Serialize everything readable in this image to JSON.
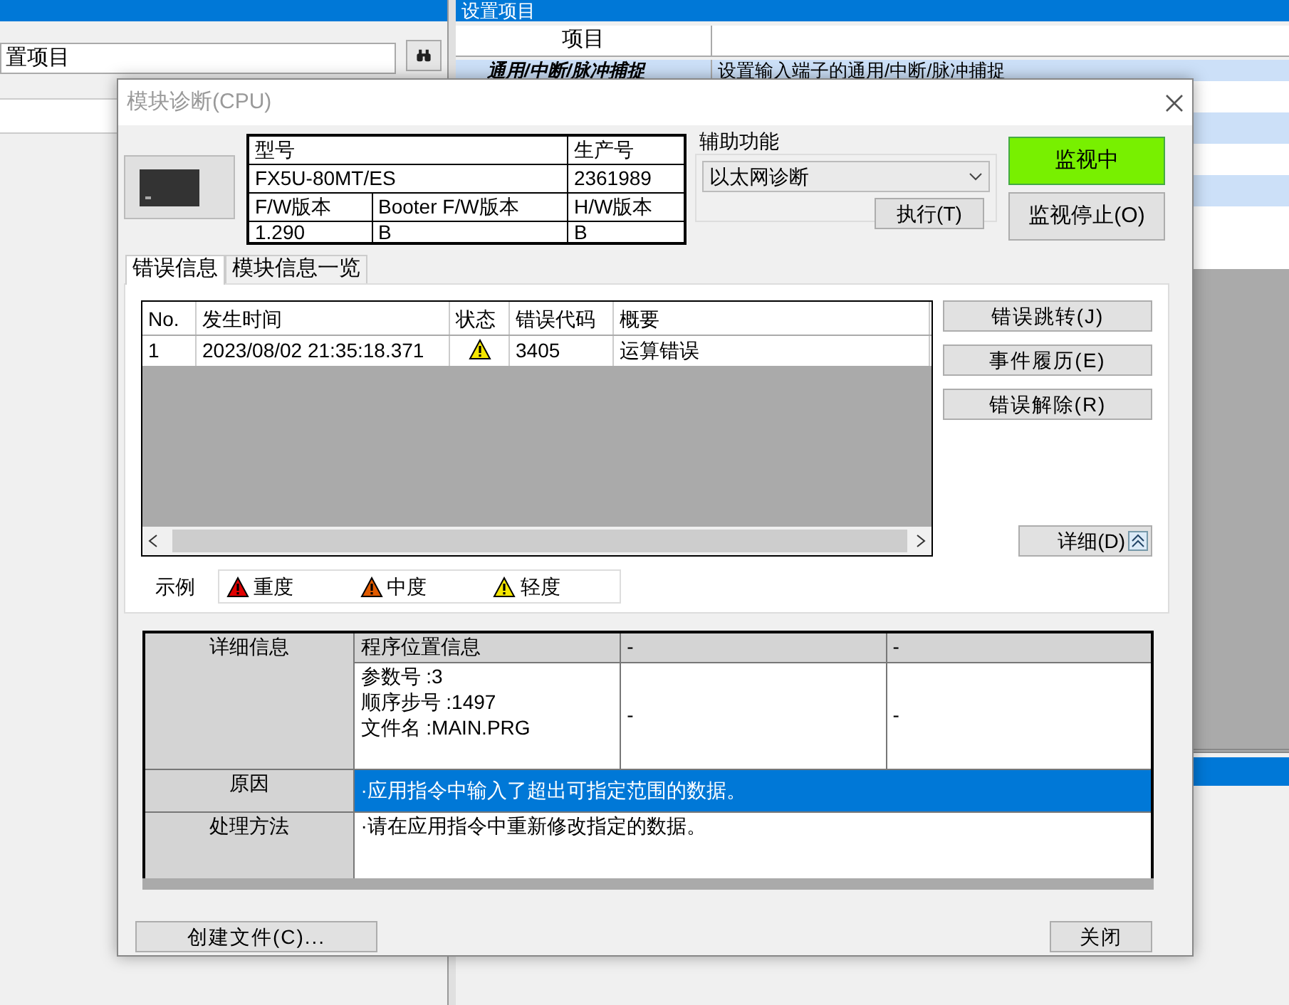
{
  "background": {
    "search_field": {
      "value": "置项目"
    },
    "right_panel": {
      "title": "设置项目",
      "columns": [
        "项目"
      ],
      "rows": [
        {
          "item": "通用/中断/脉冲捕捉",
          "description": "设置输入端子的通用/中断/脉冲捕捉",
          "selected": true
        }
      ]
    }
  },
  "dialog": {
    "title": "模块诊断(CPU)",
    "module_info": [
      [
        "型号",
        "生产号"
      ],
      [
        "FX5U-80MT/ES",
        "2361989"
      ],
      [
        "F/W版本",
        "Booter F/W版本",
        "H/W版本"
      ],
      [
        "1.290",
        "B",
        "B"
      ]
    ],
    "aux_function": {
      "label": "辅助功能",
      "value": "以太网诊断",
      "execute_button": "执行(T)"
    },
    "monitor_buttons": [
      {
        "label": "监视中",
        "active": true
      },
      {
        "label": "监视停止(O)",
        "active": false
      }
    ],
    "tabs": [
      {
        "label": "错误信息",
        "selected": true
      },
      {
        "label": "模块信息一览",
        "selected": false
      }
    ],
    "error_table": {
      "columns": [
        "No.",
        "发生时间",
        "状态",
        "错误代码",
        "概要"
      ],
      "rows": [
        {
          "no": "1",
          "time": "2023/08/02 21:35:18.371",
          "kind": "minor",
          "code": "3405",
          "summary": "运算错误"
        }
      ]
    },
    "side_buttons": [
      "错误跳转(J)",
      "事件履历(E)",
      "错误解除(R)"
    ],
    "detail_button": "详细(D)",
    "legend": {
      "label": "示例",
      "items": [
        {
          "kind": "major",
          "label": "重度"
        },
        {
          "kind": "moderate",
          "label": "中度"
        },
        {
          "kind": "minor",
          "label": "轻度"
        }
      ]
    },
    "detail": {
      "label": "详细信息",
      "columns": [
        "程序位置信息",
        "-",
        "-"
      ],
      "values": [
        [
          "参数号 :3",
          "顺序步号 :1497",
          "文件名 :MAIN.PRG"
        ],
        [
          "-"
        ],
        [
          "-"
        ]
      ]
    },
    "cause": {
      "label": "原因",
      "text": "·应用指令中输入了超出可指定范围的数据。",
      "selected": true
    },
    "remedy": {
      "label": "处理方法",
      "text": "·请在应用指令中重新修改指定的数据。"
    },
    "footer_buttons": [
      "创建文件(C)...",
      "关闭"
    ]
  }
}
